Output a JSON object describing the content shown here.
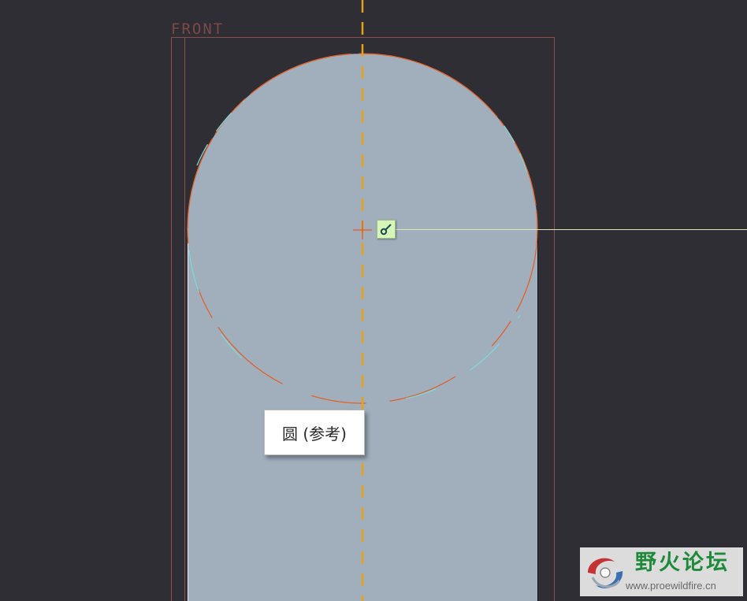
{
  "viewport": {
    "background_color": "#2f2e34",
    "part_fill_color": "#a1afbd"
  },
  "datum_plane": {
    "label": "FRONT",
    "color": "#8a4f4c"
  },
  "sketch": {
    "centerline_color": "#e8a21a",
    "arc_color": "#e0622a",
    "highlight_color": "#7fd6d9",
    "horizontal_ref_line_color": "#e6e6b4",
    "cursor_cross_color": "#e05a20"
  },
  "constraint_icon": {
    "icon": "tangent-constraint-icon",
    "background": "#d6f7b8"
  },
  "tooltip": {
    "text": "圆 (参考)"
  },
  "watermark": {
    "title": "野火论坛",
    "url": "www.proewildfire.cn",
    "title_color": "#1f8a3a"
  }
}
